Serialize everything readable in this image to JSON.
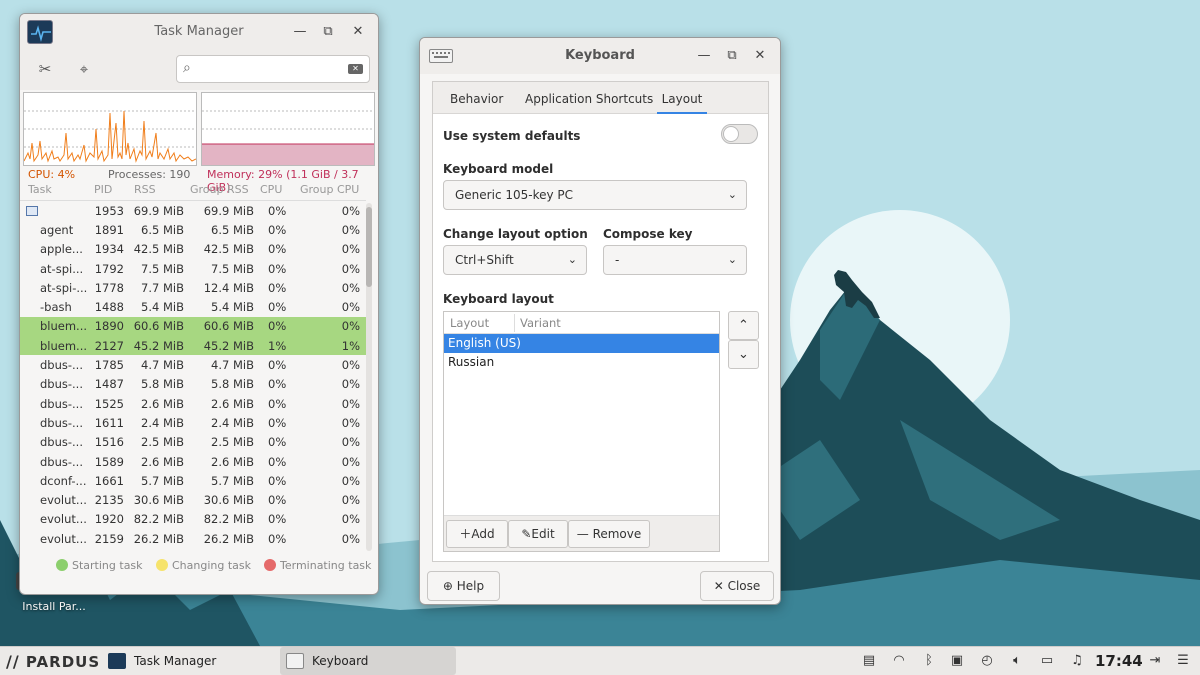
{
  "desktop": {
    "icon_label": "Install Par..."
  },
  "task_manager": {
    "title": "Task Manager",
    "search": {
      "placeholder": ""
    },
    "stats": {
      "cpu": "CPU: 4%",
      "processes": "Processes: 190",
      "memory": "Memory: 29% (1.1 GiB / 3.7 GiB)"
    },
    "columns": [
      "Task",
      "PID",
      "RSS",
      "Group RSS",
      "CPU",
      "Group CPU"
    ],
    "rows": [
      {
        "task": "",
        "pid": "1953",
        "rss": "69.9 MiB",
        "grss": "69.9 MiB",
        "cpu": "0%",
        "gcpu": "0%",
        "hl": false,
        "icon": true
      },
      {
        "task": "agent",
        "pid": "1891",
        "rss": "6.5 MiB",
        "grss": "6.5 MiB",
        "cpu": "0%",
        "gcpu": "0%",
        "hl": false
      },
      {
        "task": "apple...",
        "pid": "1934",
        "rss": "42.5 MiB",
        "grss": "42.5 MiB",
        "cpu": "0%",
        "gcpu": "0%",
        "hl": false
      },
      {
        "task": "at-spi...",
        "pid": "1792",
        "rss": "7.5 MiB",
        "grss": "7.5 MiB",
        "cpu": "0%",
        "gcpu": "0%",
        "hl": false
      },
      {
        "task": "at-spi-...",
        "pid": "1778",
        "rss": "7.7 MiB",
        "grss": "12.4 MiB",
        "cpu": "0%",
        "gcpu": "0%",
        "hl": false
      },
      {
        "task": "-bash",
        "pid": "1488",
        "rss": "5.4 MiB",
        "grss": "5.4 MiB",
        "cpu": "0%",
        "gcpu": "0%",
        "hl": false
      },
      {
        "task": "bluem...",
        "pid": "1890",
        "rss": "60.6 MiB",
        "grss": "60.6 MiB",
        "cpu": "0%",
        "gcpu": "0%",
        "hl": true
      },
      {
        "task": "bluem...",
        "pid": "2127",
        "rss": "45.2 MiB",
        "grss": "45.2 MiB",
        "cpu": "1%",
        "gcpu": "1%",
        "hl": true
      },
      {
        "task": "dbus-...",
        "pid": "1785",
        "rss": "4.7 MiB",
        "grss": "4.7 MiB",
        "cpu": "0%",
        "gcpu": "0%",
        "hl": false
      },
      {
        "task": "dbus-...",
        "pid": "1487",
        "rss": "5.8 MiB",
        "grss": "5.8 MiB",
        "cpu": "0%",
        "gcpu": "0%",
        "hl": false
      },
      {
        "task": "dbus-...",
        "pid": "1525",
        "rss": "2.6 MiB",
        "grss": "2.6 MiB",
        "cpu": "0%",
        "gcpu": "0%",
        "hl": false
      },
      {
        "task": "dbus-...",
        "pid": "1611",
        "rss": "2.4 MiB",
        "grss": "2.4 MiB",
        "cpu": "0%",
        "gcpu": "0%",
        "hl": false
      },
      {
        "task": "dbus-...",
        "pid": "1516",
        "rss": "2.5 MiB",
        "grss": "2.5 MiB",
        "cpu": "0%",
        "gcpu": "0%",
        "hl": false
      },
      {
        "task": "dbus-...",
        "pid": "1589",
        "rss": "2.6 MiB",
        "grss": "2.6 MiB",
        "cpu": "0%",
        "gcpu": "0%",
        "hl": false
      },
      {
        "task": "dconf-...",
        "pid": "1661",
        "rss": "5.7 MiB",
        "grss": "5.7 MiB",
        "cpu": "0%",
        "gcpu": "0%",
        "hl": false
      },
      {
        "task": "evolut...",
        "pid": "2135",
        "rss": "30.6 MiB",
        "grss": "30.6 MiB",
        "cpu": "0%",
        "gcpu": "0%",
        "hl": false
      },
      {
        "task": "evolut...",
        "pid": "1920",
        "rss": "82.2 MiB",
        "grss": "82.2 MiB",
        "cpu": "0%",
        "gcpu": "0%",
        "hl": false
      },
      {
        "task": "evolut...",
        "pid": "2159",
        "rss": "26.2 MiB",
        "grss": "26.2 MiB",
        "cpu": "0%",
        "gcpu": "0%",
        "hl": false
      }
    ],
    "legend": {
      "starting": "Starting task",
      "changing": "Changing task",
      "terminating": "Terminating task"
    },
    "colors": {
      "cpu": "#f07e1b",
      "memory": "#c0305a",
      "memory_fill": "#e3b4c4",
      "highlight": "#a7d781",
      "starting": "#8ccf6d",
      "changing": "#f6e36b",
      "terminating": "#e56a6a"
    }
  },
  "keyboard": {
    "title": "Keyboard",
    "tabs": [
      "Behavior",
      "Application Shortcuts",
      "Layout"
    ],
    "active_tab": "Layout",
    "use_defaults_label": "Use system defaults",
    "use_defaults_on": false,
    "model_label": "Keyboard model",
    "model_value": "Generic 105-key PC",
    "layout_option_label": "Change layout option",
    "layout_option_value": "Ctrl+Shift",
    "compose_label": "Compose key",
    "compose_value": "-",
    "layout_label": "Keyboard layout",
    "list_columns": [
      "Layout",
      "Variant"
    ],
    "layouts": [
      {
        "name": "English (US)",
        "selected": true
      },
      {
        "name": "Russian",
        "selected": false
      }
    ],
    "add_label": "Add",
    "edit_label": "Edit",
    "remove_label": "Remove",
    "help_label": "Help",
    "close_label": "Close",
    "accent": "#3584e4"
  },
  "taskbar": {
    "logo": "PARDUS",
    "tasks": [
      {
        "label": "Task Manager",
        "active": false
      },
      {
        "label": "Keyboard",
        "active": true
      }
    ],
    "clock": "17:44"
  }
}
